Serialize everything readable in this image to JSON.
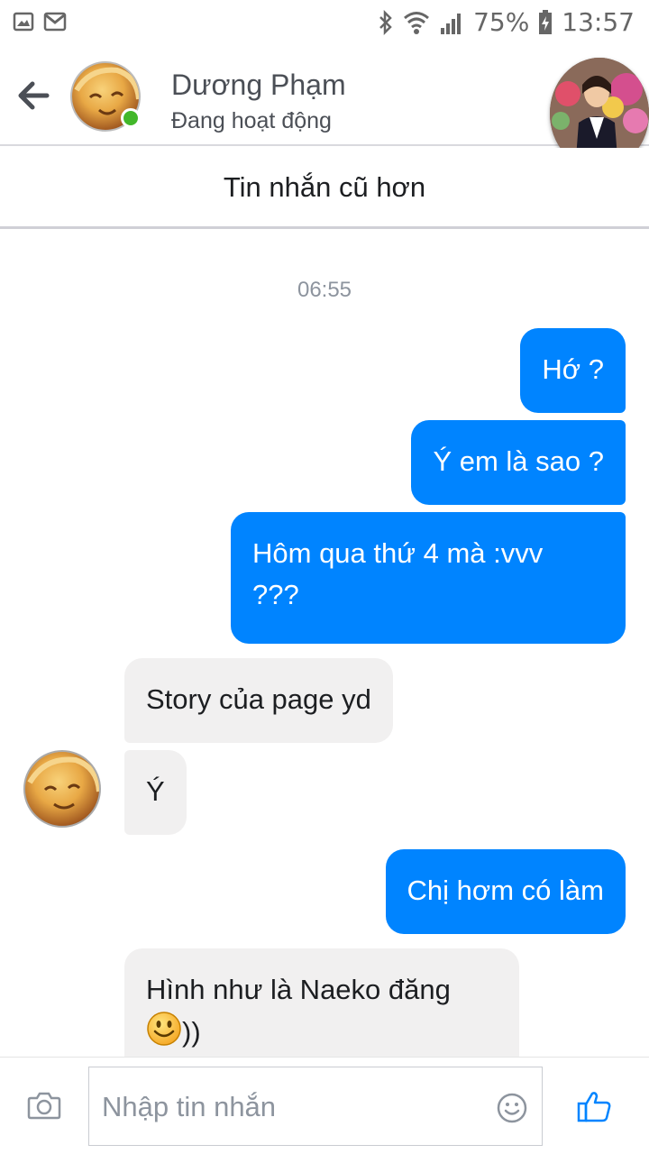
{
  "status_bar": {
    "battery": "75%",
    "time": "13:57",
    "left_icons": [
      "gallery-icon",
      "gmail-icon"
    ],
    "right_icons": [
      "bluetooth-icon",
      "wifi-icon",
      "signal-icon",
      "battery-charging-icon"
    ]
  },
  "header": {
    "contact_name": "Dương Phạm",
    "contact_status": "Đang hoạt động",
    "online_color": "#42b72a"
  },
  "older_messages_label": "Tin nhắn cũ hơn",
  "chat": {
    "timestamp": "06:55",
    "messages": [
      {
        "direction": "outgoing",
        "text": "Hớ ?"
      },
      {
        "direction": "outgoing",
        "text": "Ý em là sao ?"
      },
      {
        "direction": "outgoing",
        "line1": "Hôm qua thứ 4 mà :vvv",
        "line2": "???"
      },
      {
        "direction": "incoming",
        "text": "Story của page yd"
      },
      {
        "direction": "incoming",
        "text": "Ý"
      },
      {
        "direction": "outgoing",
        "text": "Chị hơm có làm"
      },
      {
        "direction": "incoming",
        "line1": "Hình như là Naeko đăng",
        "line2_suffix": "))",
        "emoji": "smiley-icon"
      }
    ]
  },
  "composer": {
    "placeholder": "Nhập tin nhắn"
  },
  "colors": {
    "outgoing_bubble": "#0084ff",
    "incoming_bubble": "#f1f0f0",
    "accent": "#0084ff"
  }
}
